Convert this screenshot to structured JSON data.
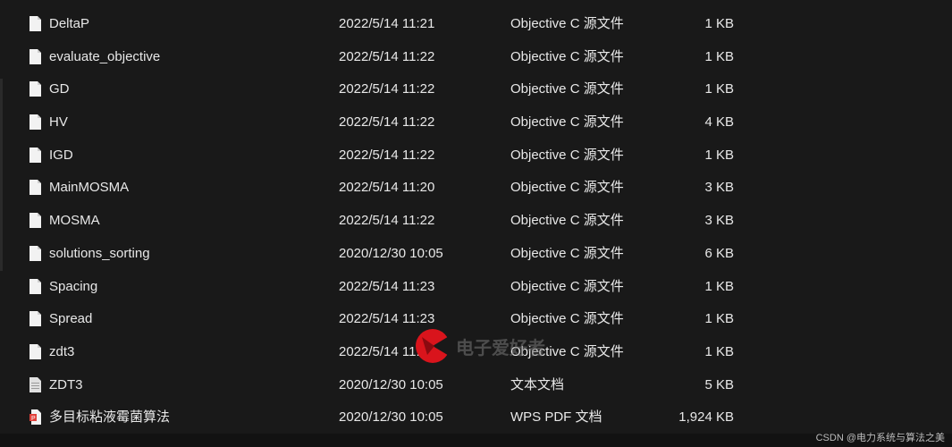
{
  "files": [
    {
      "name": "DeltaP",
      "date": "2022/5/14 11:21",
      "type": "Objective C 源文件",
      "size": "1 KB",
      "icon": "file-icon"
    },
    {
      "name": "evaluate_objective",
      "date": "2022/5/14 11:22",
      "type": "Objective C 源文件",
      "size": "1 KB",
      "icon": "file-icon"
    },
    {
      "name": "GD",
      "date": "2022/5/14 11:22",
      "type": "Objective C 源文件",
      "size": "1 KB",
      "icon": "file-icon"
    },
    {
      "name": "HV",
      "date": "2022/5/14 11:22",
      "type": "Objective C 源文件",
      "size": "4 KB",
      "icon": "file-icon"
    },
    {
      "name": "IGD",
      "date": "2022/5/14 11:22",
      "type": "Objective C 源文件",
      "size": "1 KB",
      "icon": "file-icon"
    },
    {
      "name": "MainMOSMA",
      "date": "2022/5/14 11:20",
      "type": "Objective C 源文件",
      "size": "3 KB",
      "icon": "file-icon"
    },
    {
      "name": "MOSMA",
      "date": "2022/5/14 11:22",
      "type": "Objective C 源文件",
      "size": "3 KB",
      "icon": "file-icon"
    },
    {
      "name": "solutions_sorting",
      "date": "2020/12/30 10:05",
      "type": "Objective C 源文件",
      "size": "6 KB",
      "icon": "file-icon"
    },
    {
      "name": "Spacing",
      "date": "2022/5/14 11:23",
      "type": "Objective C 源文件",
      "size": "1 KB",
      "icon": "file-icon"
    },
    {
      "name": "Spread",
      "date": "2022/5/14 11:23",
      "type": "Objective C 源文件",
      "size": "1 KB",
      "icon": "file-icon"
    },
    {
      "name": "zdt3",
      "date": "2022/5/14 11:24",
      "type": "Objective C 源文件",
      "size": "1 KB",
      "icon": "file-icon"
    },
    {
      "name": "ZDT3",
      "date": "2020/12/30 10:05",
      "type": "文本文档",
      "size": "5 KB",
      "icon": "text-file-icon"
    },
    {
      "name": "多目标粘液霉菌算法",
      "date": "2020/12/30 10:05",
      "type": "WPS PDF 文档",
      "size": "1,924 KB",
      "icon": "pdf-file-icon"
    }
  ],
  "watermark": {
    "logo_text": "电子爱好者",
    "credit": "CSDN @电力系统与算法之美"
  },
  "colors": {
    "background": "#191919",
    "text": "#e8e8e8",
    "pdf_accent": "#e0403a",
    "logo_red": "#d9141c"
  }
}
